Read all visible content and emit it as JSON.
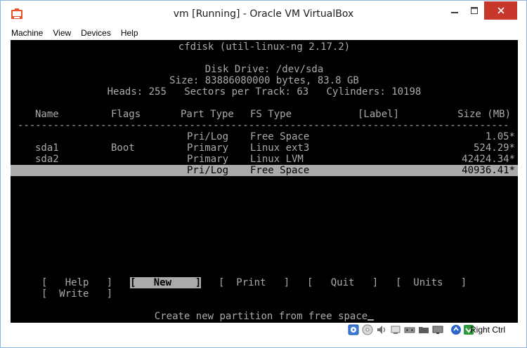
{
  "window": {
    "title": "vm [Running] - Oracle VM VirtualBox",
    "controls": {
      "minimize": "—",
      "maximize": "☐",
      "close": "✕"
    }
  },
  "menubar": {
    "items": [
      "Machine",
      "View",
      "Devices",
      "Help"
    ]
  },
  "terminal": {
    "header": "cfdisk (util-linux-ng 2.17.2)",
    "disk_drive": "Disk Drive: /dev/sda",
    "size_line": "Size: 83886080000 bytes, 83.8 GB",
    "geometry_line": "Heads: 255   Sectors per Track: 63   Cylinders: 10198",
    "columns": {
      "name": "Name",
      "flags": "Flags",
      "part_type": "Part Type",
      "fs_type": "FS Type",
      "label": "[Label]",
      "size": "Size (MB)"
    },
    "separator": "-----------------------------------------------------------------------------------------------",
    "partitions": [
      {
        "name": "",
        "flags": "",
        "part_type": "Pri/Log",
        "fs_type": "Free Space",
        "label": "",
        "size": "1.05*"
      },
      {
        "name": "sda1",
        "flags": "Boot",
        "part_type": "Primary",
        "fs_type": "Linux ext3",
        "label": "",
        "size": "524.29*"
      },
      {
        "name": "sda2",
        "flags": "",
        "part_type": "Primary",
        "fs_type": "Linux LVM",
        "label": "",
        "size": "42424.34*"
      },
      {
        "name": "",
        "flags": "",
        "part_type": "Pri/Log",
        "fs_type": "Free Space",
        "label": "",
        "size": "40936.41*"
      }
    ],
    "selected_partition": 3,
    "commands": [
      {
        "label": "[   Help   ]",
        "active": false
      },
      {
        "label": "[   New    ]",
        "active": true
      },
      {
        "label": "[  Print   ]",
        "active": false
      },
      {
        "label": "[   Quit   ]",
        "active": false
      },
      {
        "label": "[  Units   ]",
        "active": false
      },
      {
        "label": "[  Write   ]",
        "active": false
      }
    ],
    "hint": "Create new partition from free space"
  },
  "statusbar": {
    "host_key": "Right Ctrl",
    "icons": [
      "hard-disk-icon",
      "optical-drive-icon",
      "audio-icon",
      "network-icon",
      "usb-icon",
      "shared-folders-icon",
      "display-icon",
      "mouse-integration-icon",
      "keyboard-capture-icon"
    ]
  },
  "colors": {
    "terminal_bg": "#000000",
    "terminal_fg": "#aaaaaa",
    "highlight_bg": "#aaaaaa",
    "close_button": "#c7372b"
  }
}
